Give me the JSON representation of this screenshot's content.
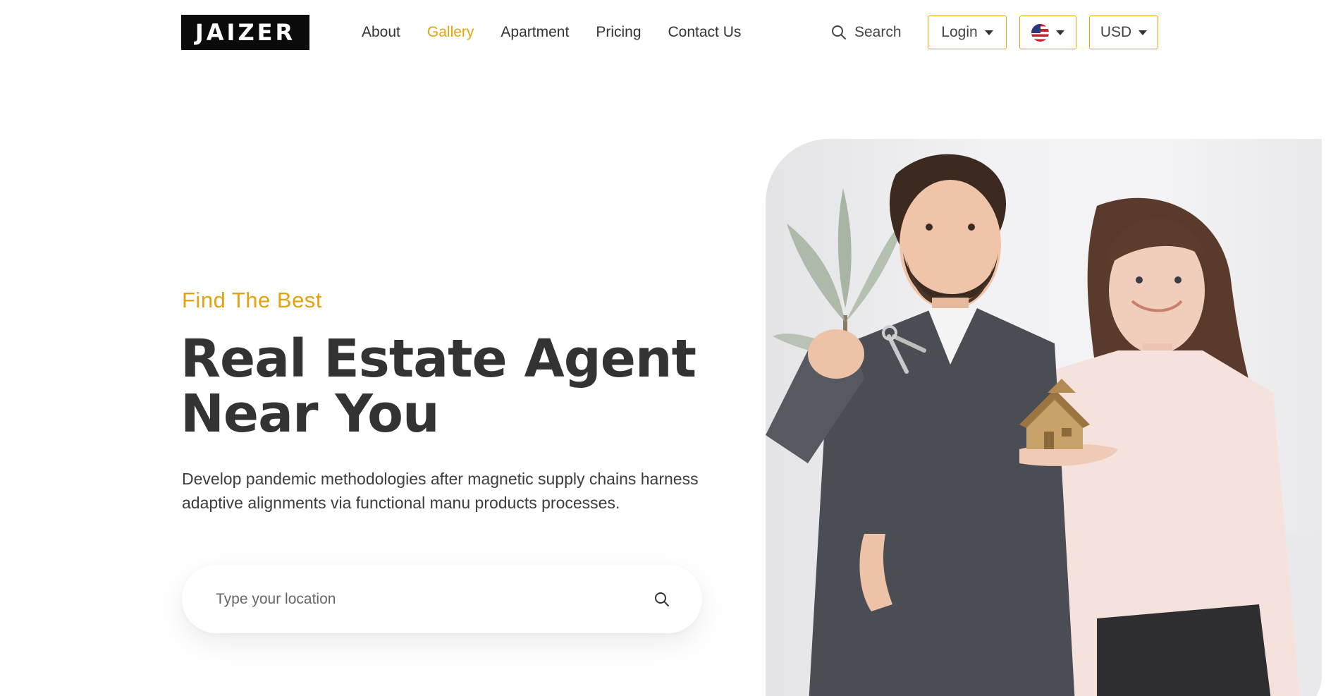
{
  "brand": {
    "logo_text": "JAIZER"
  },
  "nav": {
    "items": [
      {
        "label": "About",
        "active": false
      },
      {
        "label": "Gallery",
        "active": true
      },
      {
        "label": "Apartment",
        "active": false
      },
      {
        "label": "Pricing",
        "active": false
      },
      {
        "label": "Contact Us",
        "active": false
      }
    ]
  },
  "header": {
    "search_label": "Search",
    "login_label": "Login",
    "language_icon": "us-flag-icon",
    "currency_label": "USD"
  },
  "hero": {
    "eyebrow": "Find The Best",
    "headline_line1": "Real Estate Agent",
    "headline_line2": "Near You",
    "lead": "Develop pandemic methodologies after magnetic supply chains harness adaptive alignments via functional manu products processes.",
    "location_placeholder": "Type your location",
    "image_alt": "Couple holding house keys and a small wooden house model"
  },
  "colors": {
    "accent": "#e5a20f",
    "text_dark": "#333333",
    "logo_bg": "#0b0b0b"
  }
}
